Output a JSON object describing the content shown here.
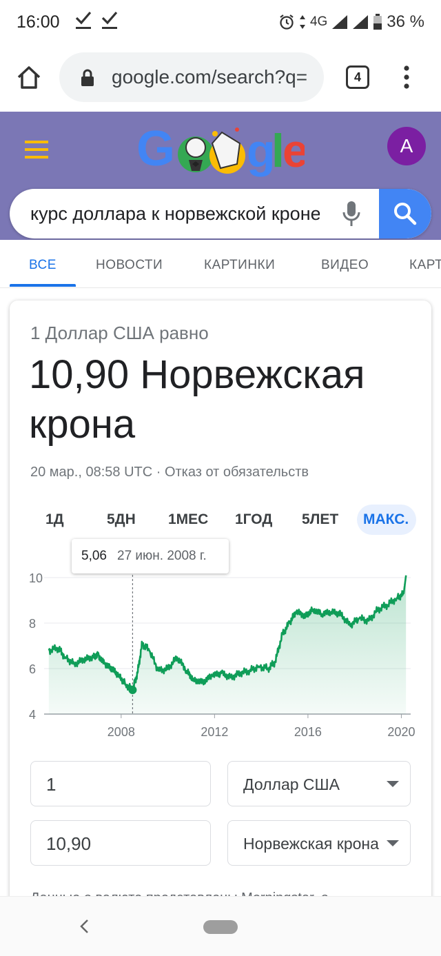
{
  "status_bar": {
    "time": "16:00",
    "network": "4G",
    "battery": "36 %",
    "icons": [
      "download-done-icon",
      "download-done-icon",
      "alarm-icon",
      "signal-icon",
      "signal-icon",
      "battery-icon"
    ]
  },
  "browser": {
    "url": "google.com/search?q=",
    "tab_count": "4"
  },
  "header": {
    "avatar_letter": "A",
    "search_query": "курс доллара к норвежской кроне",
    "colors": {
      "header_bg": "#7b77b5",
      "search_button": "#4285f4",
      "avatar": "#7b1fa2"
    }
  },
  "tabs": [
    {
      "label": "ВСЕ",
      "active": true
    },
    {
      "label": "НОВОСТИ"
    },
    {
      "label": "КАРТИНКИ"
    },
    {
      "label": "ВИДЕО"
    },
    {
      "label": "КАРТЫ"
    }
  ],
  "converter": {
    "equals_label": "1 Доллар США равно",
    "result": "10,90 Норвежская крона",
    "date": "20 мар., 08:58 UTC",
    "separator": " · ",
    "disclaimer": "Отказ от обязательств",
    "ranges": [
      "1Д",
      "5ДН",
      "1МЕС",
      "1ГОД",
      "5ЛЕТ",
      "МАКС."
    ],
    "active_range": "МАКС.",
    "tooltip_value": "5,06",
    "tooltip_date": "27 июн. 2008 г.",
    "amount_from": "1",
    "amount_to": "10,90",
    "currency_from": "Доллар США",
    "currency_to": "Норвежская крона",
    "source_text": "Данные о валюте представлены Morningstar, о"
  },
  "chart_data": {
    "type": "area",
    "color": "#0f9d58",
    "x": [
      2004.9,
      2005.3,
      2005.6,
      2006.0,
      2006.4,
      2006.8,
      2007.0,
      2007.3,
      2007.6,
      2007.9,
      2008.2,
      2008.49,
      2008.7,
      2008.9,
      2009.2,
      2009.6,
      2010.0,
      2010.4,
      2010.8,
      2011.1,
      2011.5,
      2011.9,
      2012.3,
      2012.7,
      2013.1,
      2013.5,
      2013.9,
      2014.3,
      2014.6,
      2014.9,
      2015.2,
      2015.5,
      2015.9,
      2016.2,
      2016.6,
      2017.0,
      2017.4,
      2017.8,
      2018.2,
      2018.6,
      2019.0,
      2019.4,
      2019.8,
      2020.1,
      2020.2
    ],
    "y": [
      6.8,
      6.9,
      6.5,
      6.2,
      6.4,
      6.5,
      6.6,
      6.2,
      6.0,
      5.7,
      5.3,
      5.06,
      5.8,
      7.1,
      6.8,
      5.9,
      6.0,
      6.5,
      5.9,
      5.5,
      5.4,
      5.7,
      5.8,
      5.6,
      5.8,
      5.9,
      6.1,
      6.0,
      6.3,
      7.5,
      8.0,
      8.5,
      8.3,
      8.6,
      8.4,
      8.5,
      8.4,
      7.9,
      8.2,
      8.1,
      8.6,
      8.8,
      9.1,
      9.3,
      10.1
    ],
    "xlim": [
      2004.7,
      2020.4
    ],
    "ylim": [
      4,
      10
    ],
    "yticks": [
      4,
      6,
      8,
      10
    ],
    "xticks": [
      2008,
      2012,
      2016,
      2020
    ],
    "marker": {
      "x": 2008.49,
      "y": 5.06
    },
    "grid": true
  }
}
